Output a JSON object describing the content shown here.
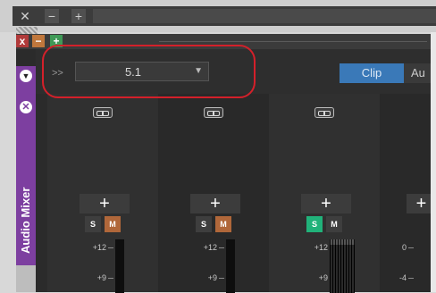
{
  "window": {
    "close_glyph": "✕",
    "minimize_glyph": "−",
    "add_glyph": "+"
  },
  "panel": {
    "header": {
      "close_glyph": "x",
      "minimize_glyph": "−",
      "maximize_glyph": "+"
    },
    "side_tab": {
      "label": "Audio Mixer",
      "collapse_glyph": "▼",
      "close_glyph": "✕"
    },
    "toolbar": {
      "expand_label": ">>",
      "channel_layout": "5.1",
      "dropdown_arrow": "▼",
      "tabs": [
        {
          "label": "Clip",
          "active": true
        },
        {
          "label": "Au"
        }
      ]
    },
    "strips": [
      {
        "add_label": "+",
        "solo_label": "S",
        "mute_label": "M",
        "mute_active": true,
        "solo_active": false,
        "scale": [
          "+12",
          "+9"
        ]
      },
      {
        "add_label": "+",
        "solo_label": "S",
        "mute_label": "M",
        "mute_active": true,
        "solo_active": false,
        "scale": [
          "+12",
          "+9"
        ]
      },
      {
        "add_label": "+",
        "solo_label": "S",
        "mute_label": "M",
        "mute_active": false,
        "solo_active": true,
        "scale": [
          "+12",
          "+9"
        ]
      },
      {
        "add_label": "+",
        "scale": [
          "0",
          "-4"
        ]
      }
    ]
  },
  "colors": {
    "side_tab": "#7d3fa0",
    "clip_tab": "#3a79b8",
    "mute": "#b0673a",
    "solo": "#21b27a",
    "highlight": "#d4202a"
  }
}
